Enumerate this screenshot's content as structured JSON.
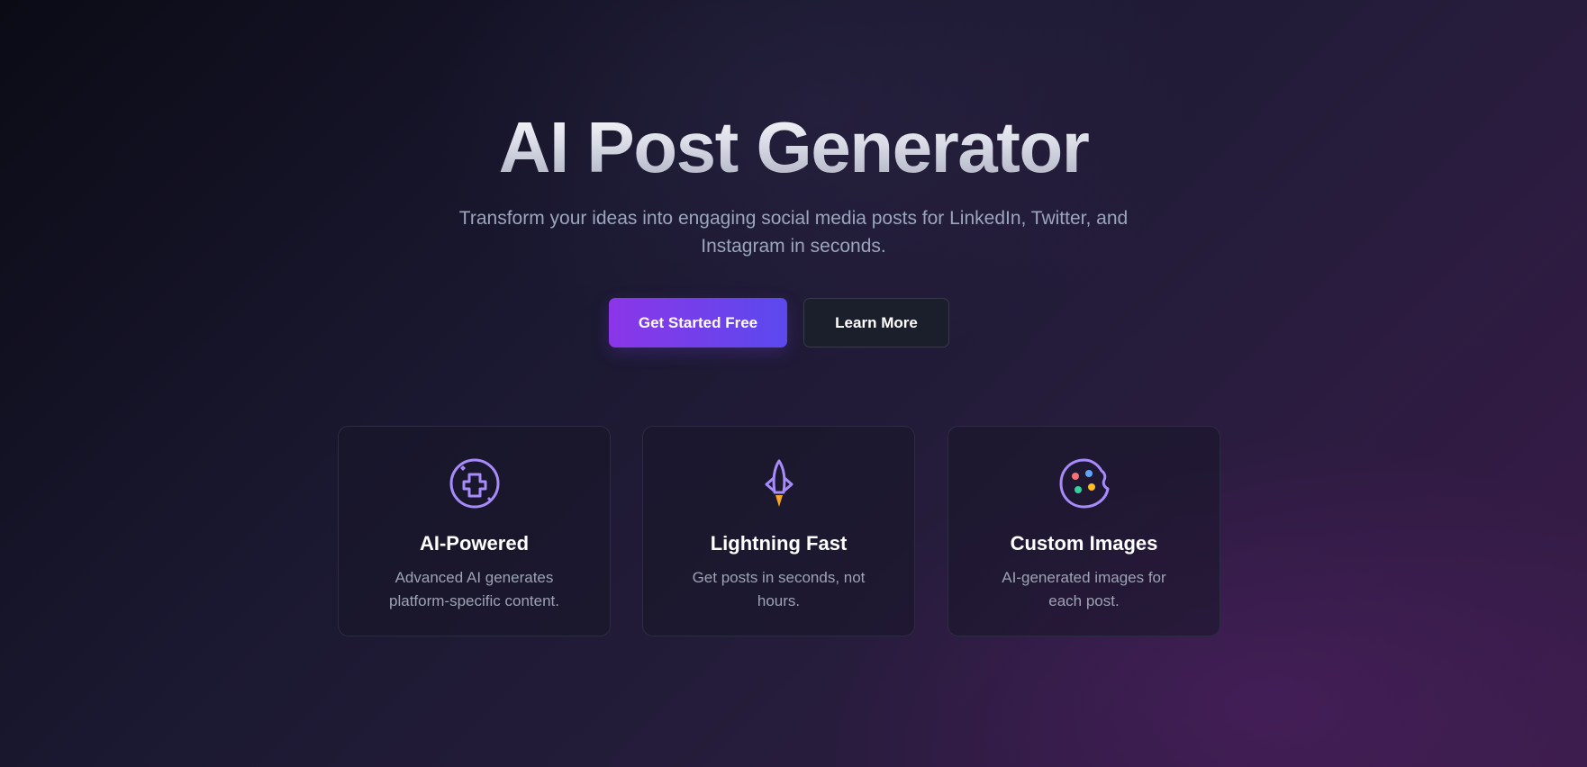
{
  "hero": {
    "title": "AI Post Generator",
    "subtitle": "Transform your ideas into engaging social media posts for LinkedIn, Twitter, and Instagram in seconds."
  },
  "actions": {
    "primary_label": "Get Started Free",
    "secondary_label": "Learn More"
  },
  "features": [
    {
      "icon": "brain-circuit-icon",
      "title": "AI-Powered",
      "description": "Advanced AI generates platform-specific content."
    },
    {
      "icon": "rocket-icon",
      "title": "Lightning Fast",
      "description": "Get posts in seconds, not hours."
    },
    {
      "icon": "palette-icon",
      "title": "Custom Images",
      "description": "AI-generated images for each post."
    }
  ],
  "colors": {
    "accent_purple": "#8b36e8",
    "accent_indigo": "#5b49ee",
    "icon_stroke": "#a78bfa",
    "text_muted": "#9ba6bd"
  }
}
